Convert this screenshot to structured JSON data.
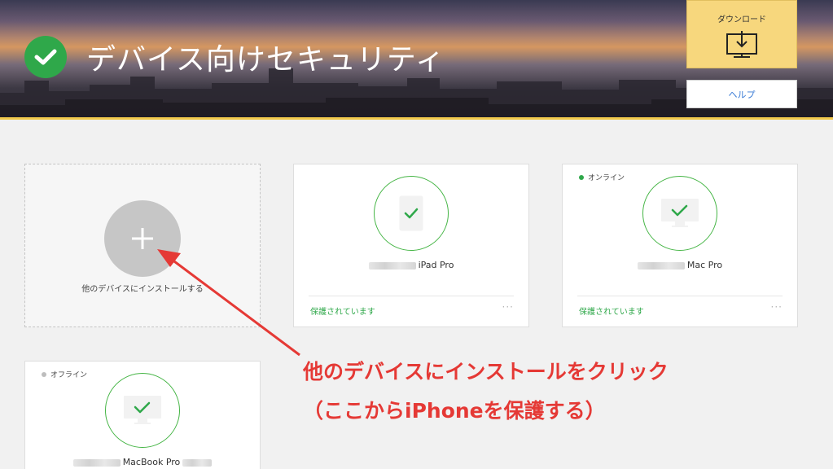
{
  "header": {
    "title": "デバイス向けセキュリティ",
    "download_label": "ダウンロード",
    "help_label": "ヘルプ"
  },
  "add_card": {
    "label": "他のデバイスにインストールする"
  },
  "devices": [
    {
      "name": "iPad Pro",
      "status": "保護されています",
      "connection": "",
      "icon": "tablet-icon"
    },
    {
      "name": "Mac Pro",
      "status": "保護されています",
      "connection": "オンライン",
      "icon": "monitor-icon"
    },
    {
      "name": "MacBook Pro",
      "status": "",
      "connection": "オフライン",
      "icon": "monitor-icon"
    }
  ],
  "annotation": {
    "line1": "他のデバイスにインストールをクリック",
    "line2": "（ここからiPhoneを保護する）"
  },
  "colors": {
    "accent_green": "#2fa84a",
    "download_yellow": "#f7d77d",
    "annotation_red": "#e53935",
    "help_blue": "#3a7bd5"
  }
}
